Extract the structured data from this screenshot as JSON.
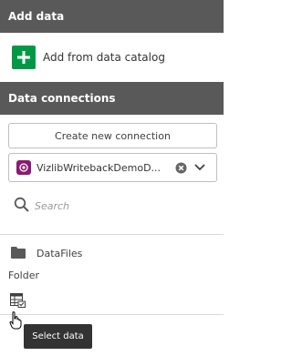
{
  "add_data": {
    "header": "Add data",
    "add_from_catalog_label": "Add from data catalog"
  },
  "data_connections": {
    "header": "Data connections",
    "create_button_label": "Create new connection",
    "selected_connection": "VizlibWritebackDemoD...",
    "search_placeholder": "Search"
  },
  "folder": {
    "name": "DataFiles",
    "subtitle": "Folder",
    "select_data_tooltip": "Select data"
  },
  "colors": {
    "header_bg": "#595959",
    "add_green": "#009845",
    "connection_icon": "#8a1b6e",
    "tooltip_bg": "#333333"
  },
  "icons": [
    "plus-icon",
    "database-icon",
    "clear-icon",
    "chevron-down-icon",
    "search-icon",
    "folder-icon",
    "select-data-icon",
    "hand-cursor-icon"
  ]
}
